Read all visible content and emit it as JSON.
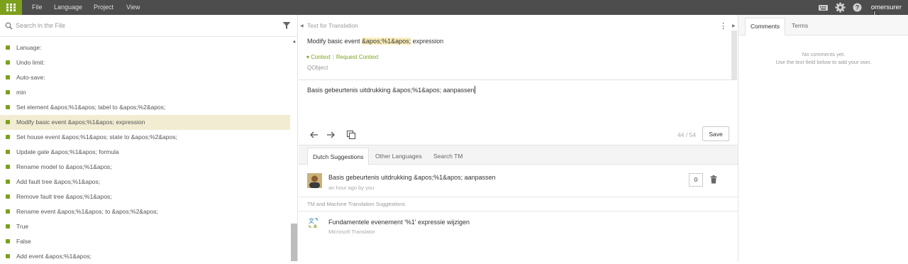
{
  "topbar": {
    "menu": [
      "File",
      "Language",
      "Project",
      "View"
    ],
    "username": "omersurer",
    "tooltip": "omersurer",
    "icons": [
      "grid-icon",
      "keyboard-icon",
      "gear-icon",
      "help-icon"
    ]
  },
  "search": {
    "placeholder": "Search in the File"
  },
  "strings": [
    "Lanuage:",
    "Undo limit:",
    "Auto-save:",
    "min",
    "Set element &apos;%1&apos; label to &apos;%2&apos;",
    "Modify basic event &apos;%1&apos; expression",
    "Set house event &apos;%1&apos; state to &apos;%2&apos;",
    "Update gate &apos;%1&apos; formula",
    "Rename model to &apos;%1&apos;",
    "Add fault tree &apos;%1&apos;",
    "Remove fault tree &apos;%1&apos;",
    "Rename event &apos;%1&apos; to &apos;%2&apos;",
    "True",
    "False",
    "Add event &apos;%1&apos;"
  ],
  "active_index": 5,
  "source": {
    "label": "Text for Translation",
    "text_before": "Modify basic event ",
    "text_highlight": "&apos;%1&apos;",
    "text_after": " expression",
    "context_label": "Context",
    "request_context": "Request Context",
    "context_value": "QObject"
  },
  "target": {
    "text": "Basis gebeurtenis uitdrukking &apos;%1&apos; aanpassen",
    "counter": "44 / 54",
    "save_label": "Save"
  },
  "tabs": [
    "Dutch Suggestions",
    "Other Languages",
    "Search TM"
  ],
  "suggestion": {
    "text": "Basis gebeurtenis uitdrukking &apos;%1&apos; aanpassen",
    "meta": "an hour ago by you",
    "votes": "0"
  },
  "tm": {
    "heading": "TM and Machine Translation Suggestions",
    "text": "Fundamentele evenement '%1' expressie wijzigen",
    "source": "Microsoft Translator"
  },
  "right": {
    "tabs": [
      "Comments",
      "Terms"
    ],
    "empty_line1": "No comments yet.",
    "empty_line2": "Use the text field below to add your own."
  },
  "colors": {
    "accent": "#7ca01c",
    "topbar": "#4d4d4d",
    "active_row": "#f2ecd2",
    "highlight": "#fbeebc"
  }
}
